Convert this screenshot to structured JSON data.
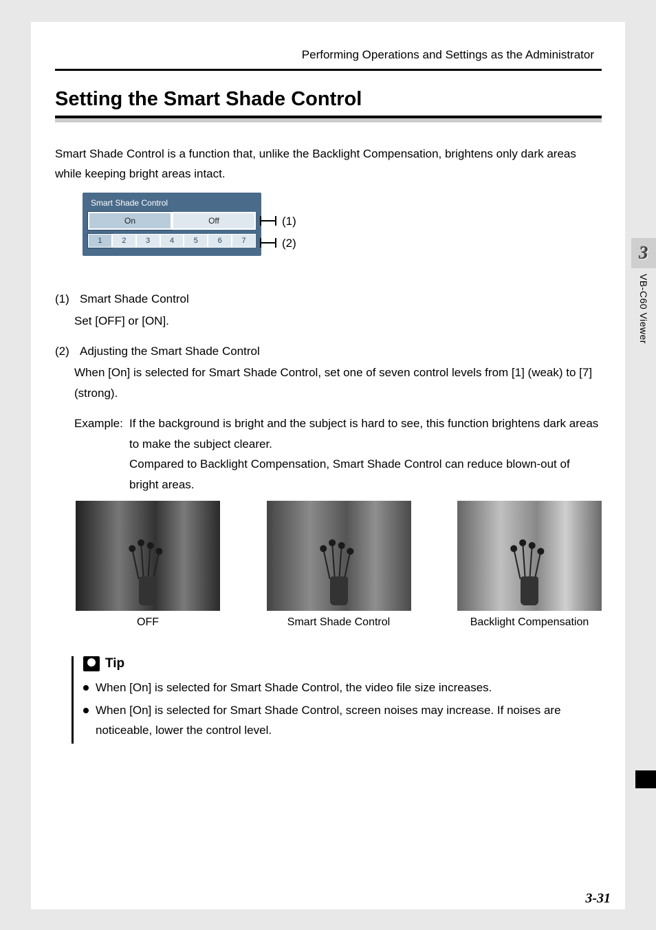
{
  "header": {
    "running_head": "Performing Operations and Settings as the Administrator"
  },
  "title": "Setting the Smart Shade Control",
  "intro": "Smart Shade Control is a function that, unlike the Backlight Compensation, brightens only dark areas while keeping bright areas intact.",
  "panel": {
    "title": "Smart Shade Control",
    "on_label": "On",
    "off_label": "Off",
    "levels": [
      "1",
      "2",
      "3",
      "4",
      "5",
      "6",
      "7"
    ]
  },
  "callouts": {
    "c1": "(1)",
    "c2": "(2)"
  },
  "items": [
    {
      "num": "(1)",
      "head": "Smart Shade Control",
      "body": "Set [OFF] or [ON]."
    },
    {
      "num": "(2)",
      "head": "Adjusting the Smart Shade Control",
      "body": "When [On] is selected for Smart Shade Control, set one of seven control levels from [1] (weak) to [7] (strong).",
      "example_label": "Example:",
      "example_text": "If the background is bright and the subject is hard to see, this function brightens dark areas to make the subject clearer.\nCompared to Backlight Compensation, Smart Shade Control can reduce blown-out of bright areas."
    }
  ],
  "figures": {
    "off": "OFF",
    "ssc": "Smart Shade Control",
    "blc": "Backlight Compensation"
  },
  "tip": {
    "title": "Tip",
    "bullets": [
      "When [On] is selected for Smart Shade Control, the video file size increases.",
      "When [On] is selected for Smart Shade Control, screen noises may increase. If noises are noticeable, lower the control level."
    ]
  },
  "sidetab": {
    "chapter_num": "3",
    "chapter_label": "VB-C60 Viewer"
  },
  "page_number": "3-31"
}
